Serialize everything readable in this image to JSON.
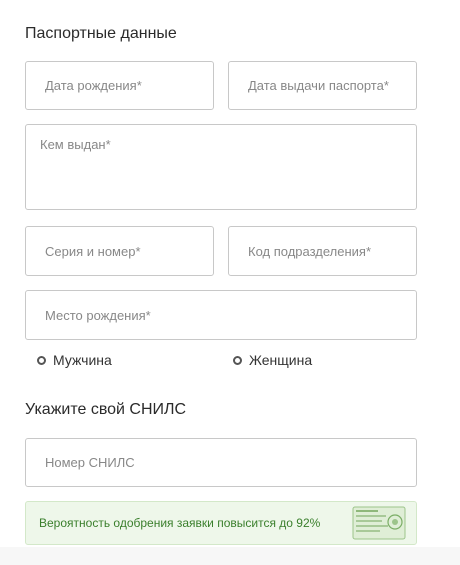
{
  "passport": {
    "title": "Паспортные данные",
    "birth_date_placeholder": "Дата рождения*",
    "issue_date_placeholder": "Дата выдачи паспорта*",
    "issued_by_placeholder": "Кем выдан*",
    "series_number_placeholder": "Серия и номер*",
    "division_code_placeholder": "Код подразделения*",
    "birth_place_placeholder": "Место рождения*"
  },
  "gender": {
    "male_label": "Мужчина",
    "female_label": "Женщина"
  },
  "snils": {
    "title": "Укажите свой СНИЛС",
    "number_placeholder": "Номер СНИЛС"
  },
  "promo": {
    "text": "Вероятность одобрения заявки повысится до 92%"
  },
  "colors": {
    "promo_background": "#eef7ea",
    "promo_text": "#3a7f2c",
    "field_border": "#c8c8c8"
  }
}
